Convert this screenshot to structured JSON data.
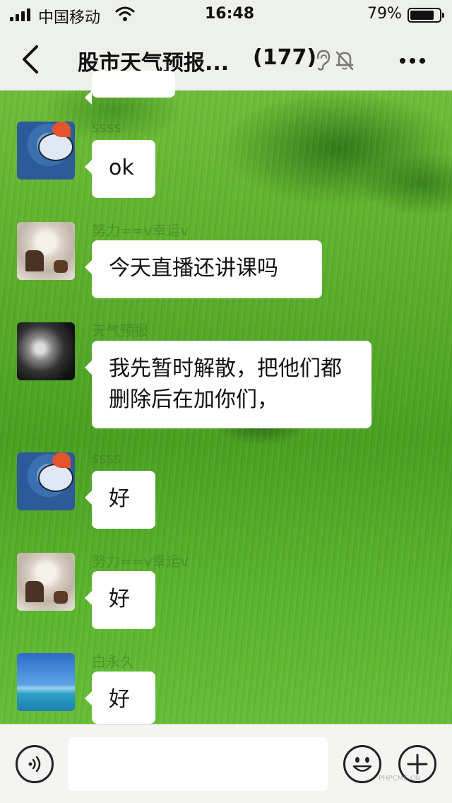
{
  "status_bar": {
    "carrier": "中国移动",
    "time": "16:48",
    "battery_percent": "79%",
    "battery_level": 0.79
  },
  "header": {
    "title": "股市天气预报...",
    "member_count": "(177)",
    "icons": [
      "back-icon",
      "ear-icon",
      "mute-bell-icon",
      "more-icon"
    ]
  },
  "messages": [
    {
      "sender": "",
      "text": "",
      "avatar": "none"
    },
    {
      "sender": "ssss",
      "text": "ok",
      "avatar": "fish-avatar"
    },
    {
      "sender": "努力==v幸运v",
      "text": "今天直播还讲课吗",
      "avatar": "deer-avatar"
    },
    {
      "sender": "天气预报",
      "text": "我先暂时解散，把他们都删除后在加你们，",
      "avatar": "horse-avatar"
    },
    {
      "sender": "ssss",
      "text": "好",
      "avatar": "fish-avatar"
    },
    {
      "sender": "努力==v幸运v",
      "text": "好",
      "avatar": "deer-avatar"
    },
    {
      "sender": "白永久",
      "text": "好",
      "avatar": "sea-avatar"
    }
  ],
  "input_bar": {
    "message_value": "",
    "icons": [
      "voice-icon",
      "emoji-icon",
      "plus-icon"
    ]
  },
  "watermark": "PHPCMS.CN"
}
